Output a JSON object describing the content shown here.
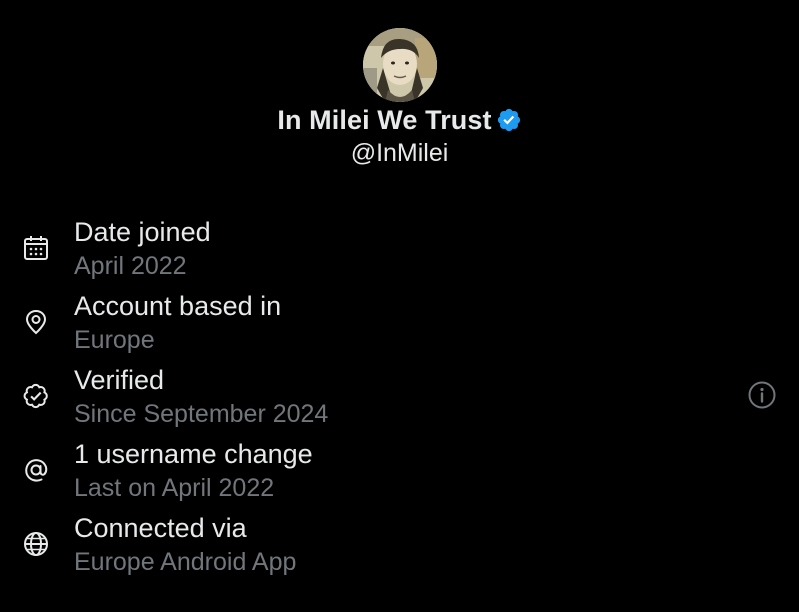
{
  "profile": {
    "display_name": "In Milei We Trust",
    "handle": "@InMilei",
    "verified_color": "#1d9bf0"
  },
  "info": [
    {
      "icon": "calendar-icon",
      "title": "Date joined",
      "subtitle": "April 2022"
    },
    {
      "icon": "location-pin-icon",
      "title": "Account based in",
      "subtitle": "Europe"
    },
    {
      "icon": "verified-badge-outline-icon",
      "title": "Verified",
      "subtitle": "Since September 2024",
      "extra_icon": "info-circle-icon"
    },
    {
      "icon": "at-sign-icon",
      "title": "1 username change",
      "subtitle": "Last on April 2022"
    },
    {
      "icon": "globe-icon",
      "title": "Connected via",
      "subtitle": "Europe Android App"
    }
  ]
}
